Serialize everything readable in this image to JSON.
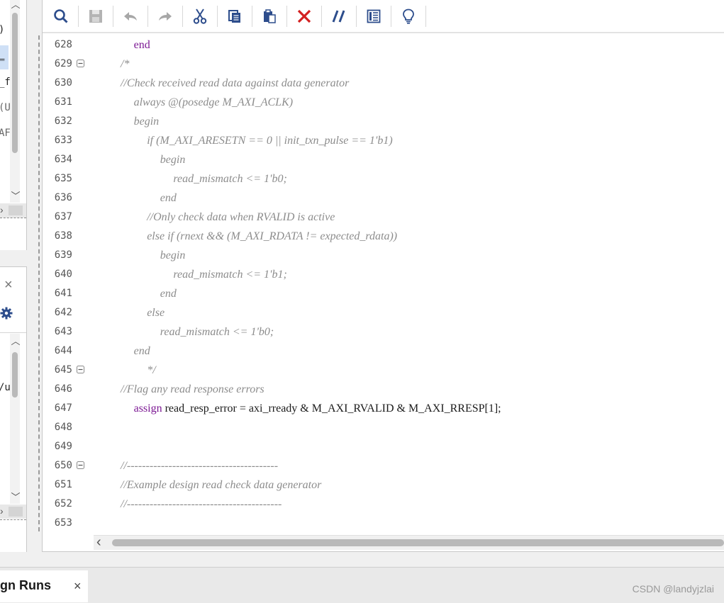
{
  "left_panel": {
    "top_fragments": [
      ")",
      "_",
      "_f",
      "(U",
      "AF"
    ],
    "bottom_fragments": [
      "/u"
    ]
  },
  "toolbar": {
    "buttons": [
      {
        "name": "search-button",
        "icon": "search-icon"
      },
      {
        "name": "save-button",
        "icon": "save-icon"
      },
      {
        "name": "undo-button",
        "icon": "undo-icon"
      },
      {
        "name": "redo-button",
        "icon": "redo-icon"
      },
      {
        "name": "cut-button",
        "icon": "scissors-icon"
      },
      {
        "name": "copy-button",
        "icon": "copy-icon"
      },
      {
        "name": "paste-button",
        "icon": "paste-icon"
      },
      {
        "name": "delete-button",
        "icon": "delete-x-icon"
      },
      {
        "name": "toggle-comment-button",
        "icon": "comment-slashes-icon"
      },
      {
        "name": "insert-template-button",
        "icon": "template-icon"
      },
      {
        "name": "quick-help-button",
        "icon": "lightbulb-icon"
      }
    ]
  },
  "editor": {
    "lines": [
      {
        "num": "628",
        "indent": 2,
        "parts": [
          [
            "kw",
            "end"
          ]
        ]
      },
      {
        "num": "629",
        "indent": 0,
        "fold": true,
        "parts": [
          [
            "cm",
            "/*"
          ]
        ]
      },
      {
        "num": "630",
        "indent": 0,
        "parts": [
          [
            "cm",
            "//Check received read data against data generator"
          ]
        ]
      },
      {
        "num": "631",
        "indent": 2,
        "parts": [
          [
            "cm",
            "always @(posedge M_AXI_ACLK)"
          ]
        ]
      },
      {
        "num": "632",
        "indent": 2,
        "parts": [
          [
            "cm",
            "begin"
          ]
        ]
      },
      {
        "num": "633",
        "indent": 4,
        "parts": [
          [
            "cm",
            "if (M_AXI_ARESETN == 0 || init_txn_pulse == 1'b1)"
          ]
        ]
      },
      {
        "num": "634",
        "indent": 6,
        "parts": [
          [
            "cm",
            "begin"
          ]
        ]
      },
      {
        "num": "635",
        "indent": 8,
        "parts": [
          [
            "cm",
            "read_mismatch <= 1'b0;"
          ]
        ]
      },
      {
        "num": "636",
        "indent": 6,
        "parts": [
          [
            "cm",
            "end"
          ]
        ]
      },
      {
        "num": "637",
        "indent": 4,
        "parts": [
          [
            "cm",
            "//Only check data when RVALID is active"
          ]
        ]
      },
      {
        "num": "638",
        "indent": 4,
        "parts": [
          [
            "cm",
            "else if (rnext && (M_AXI_RDATA != expected_rdata))"
          ]
        ]
      },
      {
        "num": "639",
        "indent": 6,
        "parts": [
          [
            "cm",
            "begin"
          ]
        ]
      },
      {
        "num": "640",
        "indent": 8,
        "parts": [
          [
            "cm",
            "read_mismatch <= 1'b1;"
          ]
        ]
      },
      {
        "num": "641",
        "indent": 6,
        "parts": [
          [
            "cm",
            "end"
          ]
        ]
      },
      {
        "num": "642",
        "indent": 4,
        "parts": [
          [
            "cm",
            "else"
          ]
        ]
      },
      {
        "num": "643",
        "indent": 6,
        "parts": [
          [
            "cm",
            "read_mismatch <= 1'b0;"
          ]
        ]
      },
      {
        "num": "644",
        "indent": 2,
        "parts": [
          [
            "cm",
            "end"
          ]
        ]
      },
      {
        "num": "645",
        "indent": 4,
        "fold": true,
        "parts": [
          [
            "cm",
            "*/"
          ]
        ]
      },
      {
        "num": "646",
        "indent": 0,
        "parts": [
          [
            "cm",
            "//Flag any read response errors"
          ]
        ]
      },
      {
        "num": "647",
        "indent": 2,
        "parts": [
          [
            "kw",
            "assign"
          ],
          [
            "tx",
            " read_resp_error = axi_rready & M_AXI_RVALID & M_AXI_RRESP[1];"
          ]
        ]
      },
      {
        "num": "648",
        "indent": 0,
        "parts": []
      },
      {
        "num": "649",
        "indent": 0,
        "parts": []
      },
      {
        "num": "650",
        "indent": 0,
        "fold": true,
        "parts": [
          [
            "cm",
            "//----------------------------------------"
          ]
        ]
      },
      {
        "num": "651",
        "indent": 0,
        "parts": [
          [
            "cm",
            "//Example design read check data generator"
          ]
        ]
      },
      {
        "num": "652",
        "indent": 0,
        "parts": [
          [
            "cm",
            "//-----------------------------------------"
          ]
        ]
      },
      {
        "num": "653",
        "indent": 0,
        "parts": []
      }
    ]
  },
  "bottom_tab": {
    "label": "gn Runs",
    "close": "×"
  },
  "watermark": "CSDN @landyjzlai",
  "panel_close": "×",
  "colors": {
    "keyword": "#7d1a94",
    "comment": "#8c8c8c",
    "delete": "#d32020",
    "icon_blue": "#2d4d8c"
  }
}
